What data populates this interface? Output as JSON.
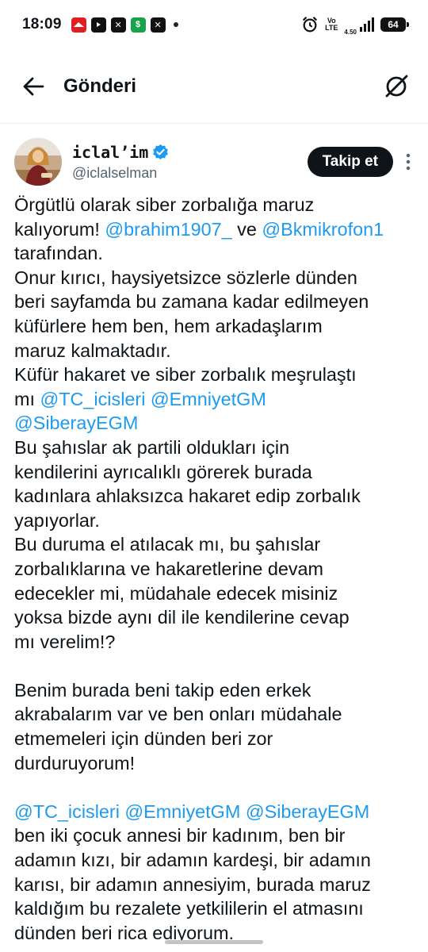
{
  "status_bar": {
    "time": "18:09",
    "net_speed": "4.50",
    "network_label_top": "Vo",
    "network_label_bottom": "LTE",
    "battery": "64"
  },
  "header": {
    "title": "Gönderi",
    "back_icon": "arrow-left-icon",
    "grok_icon": "grok-icon"
  },
  "post": {
    "author": {
      "display_name": "iclal’im",
      "handle": "@iclalselman",
      "verified": true
    },
    "follow_label": "Takip et",
    "lines": [
      [
        {
          "t": "Örgütlü olarak siber zorbalığa maruz"
        }
      ],
      [
        {
          "t": "kalıyorum! "
        },
        {
          "m": "@brahim1907_"
        },
        {
          "t": " ve "
        },
        {
          "m": "@Bkmikrofon1"
        }
      ],
      [
        {
          "t": "tarafından."
        }
      ],
      [
        {
          "t": "Onur kırıcı, haysiyetsizce sözlerle dünden"
        }
      ],
      [
        {
          "t": "beri sayfamda bu zamana kadar edilmeyen"
        }
      ],
      [
        {
          "t": "küfürlere hem ben, hem arkadaşlarım"
        }
      ],
      [
        {
          "t": "maruz kalmaktadır."
        }
      ],
      [
        {
          "t": "Küfür hakaret ve siber zorbalık meşrulaştı"
        }
      ],
      [
        {
          "t": "mı "
        },
        {
          "m": "@TC_icisleri"
        },
        {
          "t": " "
        },
        {
          "m": "@EmniyetGM"
        }
      ],
      [
        {
          "m": "@SiberayEGM"
        }
      ],
      [
        {
          "t": "Bu şahıslar ak partili oldukları için"
        }
      ],
      [
        {
          "t": "kendilerini ayrıcalıklı görerek burada"
        }
      ],
      [
        {
          "t": "kadınlara ahlaksızca hakaret edip zorbalık"
        }
      ],
      [
        {
          "t": "yapıyorlar."
        }
      ],
      [
        {
          "t": "Bu duruma el atılacak mı, bu şahıslar"
        }
      ],
      [
        {
          "t": "zorbalıklarına ve hakaretlerine devam"
        }
      ],
      [
        {
          "t": "edecekler mi, müdahale edecek misiniz"
        }
      ],
      [
        {
          "t": "yoksa bizde aynı dil ile kendilerine cevap"
        }
      ],
      [
        {
          "t": "mı verelim!?"
        }
      ],
      [],
      [
        {
          "t": "Benim burada beni takip eden erkek"
        }
      ],
      [
        {
          "t": "akrabalarım var ve ben onları müdahale"
        }
      ],
      [
        {
          "t": "etmemeleri için dünden beri zor"
        }
      ],
      [
        {
          "t": "durduruyorum!"
        }
      ],
      [],
      [
        {
          "m": "@TC_icisleri"
        },
        {
          "t": " "
        },
        {
          "m": "@EmniyetGM"
        },
        {
          "t": " "
        },
        {
          "m": "@SiberayEGM"
        }
      ],
      [
        {
          "t": "ben iki çocuk annesi bir kadınım, ben bir"
        }
      ],
      [
        {
          "t": "adamın kızı, bir adamın kardeşi, bir adamın"
        }
      ],
      [
        {
          "t": "karısı, bir adamın annesiyim, burada maruz"
        }
      ],
      [
        {
          "t": "kaldığım bu rezalete yetkililerin el atmasını"
        }
      ],
      [
        {
          "t": "dünden beri rica ediyorum."
        }
      ]
    ]
  },
  "colors": {
    "text": "#0f1419",
    "secondary": "#536471",
    "link": "#1d9bf0",
    "button_bg": "#0f1419"
  }
}
